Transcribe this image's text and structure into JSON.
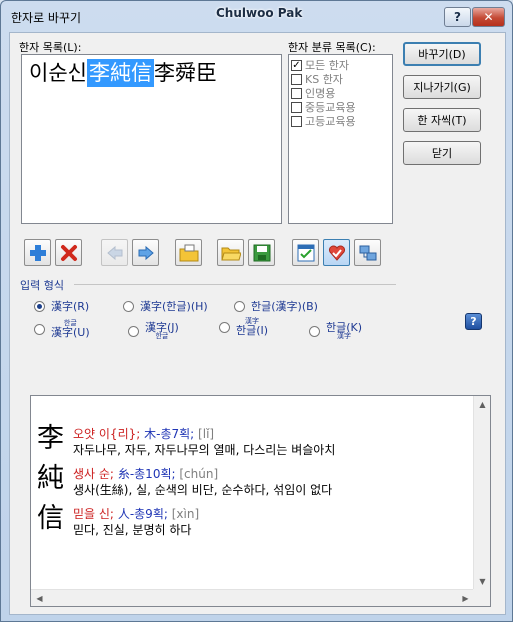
{
  "window": {
    "title": "한자로 바꾸기",
    "watermark": "Chulwoo Pak",
    "help_glyph": "?",
    "close_glyph": "✕"
  },
  "hanja_list": {
    "label": "한자 목록(L):",
    "before": "이순신",
    "selected": "李純信",
    "after": "李舜臣"
  },
  "category": {
    "label": "한자 분류 목록(C):",
    "items": [
      {
        "label": "모든 한자",
        "checked": true
      },
      {
        "label": "KS 한자",
        "checked": false
      },
      {
        "label": "인명용",
        "checked": false
      },
      {
        "label": "중등교육용",
        "checked": false
      },
      {
        "label": "고등교육용",
        "checked": false
      }
    ]
  },
  "buttons": {
    "replace": "바꾸기(D)",
    "skip": "지나가기(G)",
    "one_char": "한 자씩(T)",
    "close": "닫기"
  },
  "toolbar": [
    {
      "name": "add-icon"
    },
    {
      "name": "delete-icon"
    },
    {
      "name": "arrow-left-icon",
      "disabled": true
    },
    {
      "name": "arrow-right-icon"
    },
    {
      "name": "folder-abc-icon"
    },
    {
      "name": "folder-open-icon"
    },
    {
      "name": "save-icon"
    },
    {
      "name": "checklist-icon"
    },
    {
      "name": "heart-check-icon",
      "pressed": true
    },
    {
      "name": "network-icon"
    }
  ],
  "input_format": {
    "label": "입력 형식",
    "row1": [
      {
        "label": "漢字(R)",
        "selected": true
      },
      {
        "label": "漢字(한글)(H)",
        "selected": false
      },
      {
        "label": "한글(漢字)(B)",
        "selected": false
      }
    ],
    "row2": [
      {
        "top": "한글",
        "main": "漢字(U)",
        "bottom": ""
      },
      {
        "top": "",
        "main": "漢字(J)",
        "bottom": "한글"
      },
      {
        "top": "漢字",
        "main": "한글(I)",
        "bottom": ""
      },
      {
        "top": "",
        "main": "한글(K)",
        "bottom": "漢字"
      }
    ]
  },
  "detail": {
    "entries": [
      {
        "char": "李",
        "reading": "오얏 이{리};",
        "radical": "木-총7획;",
        "pinyin": "[lǐ]",
        "meaning": "자두나무, 자두, 자두나무의 열매, 다스리는 벼슬아치"
      },
      {
        "char": "純",
        "reading": "생사 순;",
        "radical": "糸-총10획;",
        "pinyin": "[chún]",
        "meaning": "생사(生絲), 실, 순색의 비단, 순수하다, 섞임이 없다"
      },
      {
        "char": "信",
        "reading": "믿을 신;",
        "radical": "人-총9획;",
        "pinyin": "[xìn]",
        "meaning": "믿다, 진실, 분명히 하다"
      }
    ]
  },
  "colors": {
    "selection": "#3399ff",
    "reading_red": "#cc2020",
    "radical_blue": "#1f35b5"
  }
}
